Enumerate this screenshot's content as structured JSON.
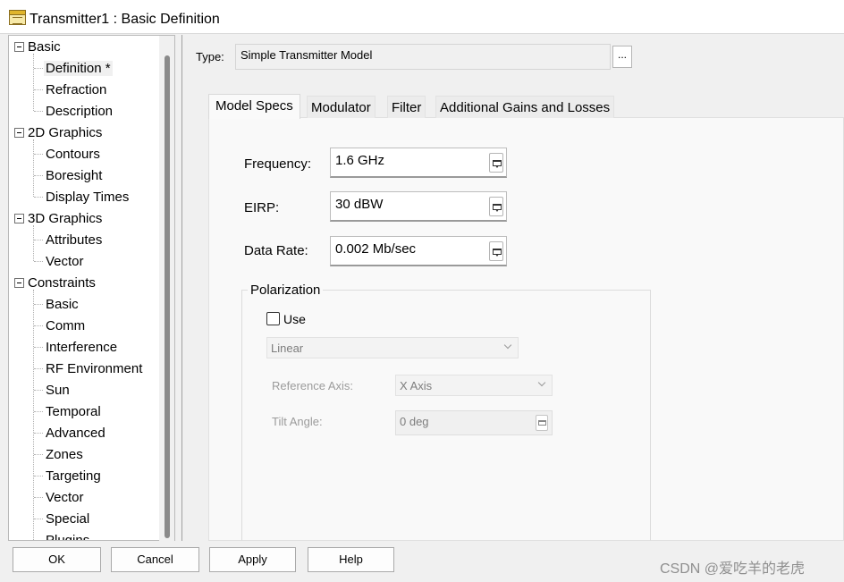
{
  "window": {
    "title": "Transmitter1 : Basic Definition"
  },
  "tree": {
    "groups": [
      {
        "label": "Basic",
        "children": [
          "Definition *",
          "Refraction",
          "Description"
        ]
      },
      {
        "label": "2D Graphics",
        "children": [
          "Contours",
          "Boresight",
          "Display Times"
        ]
      },
      {
        "label": "3D Graphics",
        "children": [
          "Attributes",
          "Vector"
        ]
      },
      {
        "label": "Constraints",
        "children": [
          "Basic",
          "Comm",
          "Interference",
          "RF Environment",
          "Sun",
          "Temporal",
          "Advanced",
          "Zones",
          "Targeting",
          "Vector",
          "Special",
          "Plugins"
        ]
      }
    ],
    "selected": "Definition *"
  },
  "type_row": {
    "label": "Type:",
    "value": "Simple Transmitter Model",
    "browse_label": "..."
  },
  "tabs": [
    "Model Specs",
    "Modulator",
    "Filter",
    "Additional Gains and Losses"
  ],
  "active_tab": "Model Specs",
  "fields": {
    "frequency": {
      "label": "Frequency:",
      "value": "1.6 GHz"
    },
    "eirp": {
      "label": "EIRP:",
      "value": "30 dBW"
    },
    "data_rate": {
      "label": "Data Rate:",
      "value": "0.002 Mb/sec"
    }
  },
  "polarization": {
    "title": "Polarization",
    "use_label": "Use",
    "use_checked": false,
    "type_value": "Linear",
    "reference_axis": {
      "label": "Reference Axis:",
      "value": "X Axis"
    },
    "tilt_angle": {
      "label": "Tilt Angle:",
      "value": "0 deg"
    }
  },
  "buttons": {
    "ok": "OK",
    "cancel": "Cancel",
    "apply": "Apply",
    "help": "Help"
  },
  "watermark": "CSDN @爱吃羊的老虎",
  "colors": {
    "window_bg": "#f0f0f0",
    "tree_bg": "#ffffff",
    "selected_bg": "#f0f0f0"
  }
}
